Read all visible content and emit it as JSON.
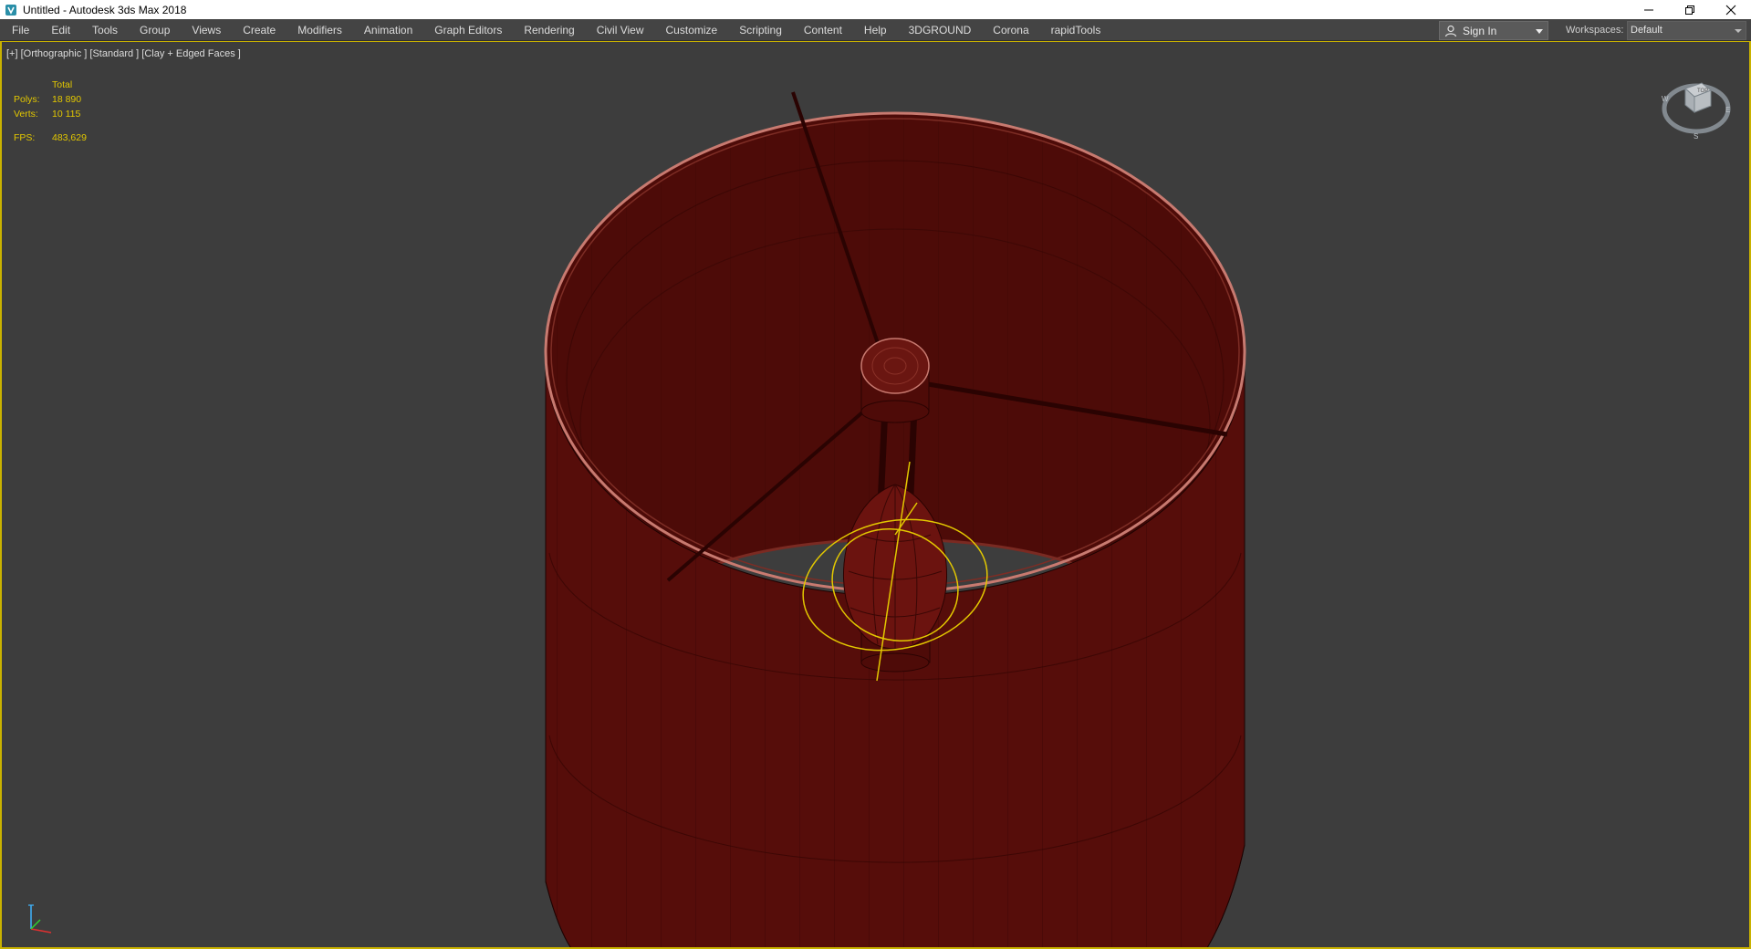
{
  "window": {
    "title": "Untitled - Autodesk 3ds Max 2018"
  },
  "menu": {
    "items": [
      "File",
      "Edit",
      "Tools",
      "Group",
      "Views",
      "Create",
      "Modifiers",
      "Animation",
      "Graph Editors",
      "Rendering",
      "Civil View",
      "Customize",
      "Scripting",
      "Content",
      "Help",
      "3DGROUND",
      "Corona",
      "rapidTools"
    ]
  },
  "account": {
    "sign_in_label": "Sign In"
  },
  "workspaces": {
    "label": "Workspaces:",
    "selected": "Default"
  },
  "viewport": {
    "label": "[+] [Orthographic ] [Standard ] [Clay + Edged Faces ]",
    "stats": {
      "header": "Total",
      "polys_label": "Polys:",
      "polys_value": "18 890",
      "verts_label": "Verts:",
      "verts_value": "10 115",
      "fps_label": "FPS:",
      "fps_value": "483,629"
    },
    "selection_color": "#e3c800",
    "object_color": "#5a0f0c"
  },
  "icons": {
    "app": "3dsmax-icon",
    "minimize": "minimize-icon",
    "restore": "restore-icon",
    "close": "close-icon",
    "user": "user-icon",
    "viewcube": "viewcube-icon",
    "axis": "axis-tripod-icon"
  }
}
